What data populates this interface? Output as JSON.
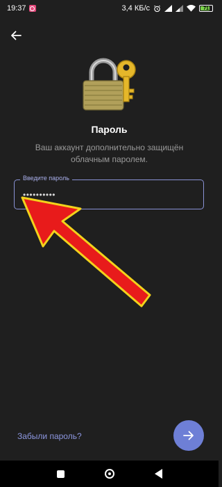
{
  "status_bar": {
    "time": "19:37",
    "network_speed": "3,4 КБ/с",
    "battery": "71"
  },
  "screen": {
    "title": "Пароль",
    "subtitle": "Ваш аккаунт дополнительно защищён облачным паролем."
  },
  "password_field": {
    "label": "Введите пароль",
    "value": "••••••••••"
  },
  "footer": {
    "forgot_label": "Забыли пароль?"
  },
  "colors": {
    "background": "#1f1f1f",
    "accent": "#6e7fd6",
    "input_border": "#8a93d6",
    "annotation_arrow": "#e81b1b"
  },
  "icons": {
    "back": "arrow-left-icon",
    "next": "arrow-right-icon",
    "illustration": "padlock-key-icon"
  }
}
